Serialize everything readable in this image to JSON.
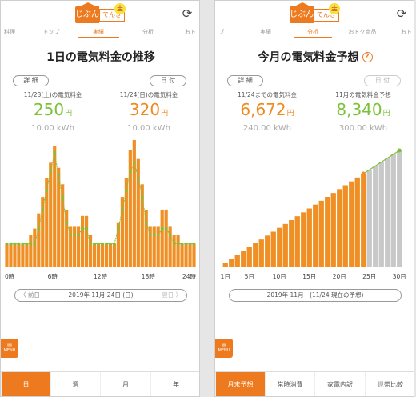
{
  "colors": {
    "accent": "#ee7a1f",
    "bar": "#ef8f24",
    "line": "#7cc13a",
    "forecast": "#c8c8c8"
  },
  "icons": {
    "refresh": "refresh-icon",
    "menu": "menu-icon",
    "help": "help-icon"
  },
  "logo": {
    "left": "じぶん",
    "right": "でんき",
    "coin": "圭"
  },
  "screen1": {
    "tabs": [
      "料理",
      "トップ",
      "実績",
      "分析",
      "おト"
    ],
    "active_tab": 2,
    "title": "1日の電気料金の推移",
    "detail_button": "詳 細",
    "date_button": "日 付",
    "left": {
      "label": "11/23(土)の電気料金",
      "value": "250",
      "unit": "円",
      "sub": "10.00 kWh"
    },
    "right": {
      "label": "11/24(日)の電気料金",
      "value": "320",
      "unit": "円",
      "sub": "10.00 kWh"
    },
    "date_nav": {
      "prev": "前日",
      "date": "2019年 11月 24日 (日)",
      "next": "翌日"
    },
    "menu_label": "MENU",
    "bottom_tabs": [
      "日",
      "週",
      "月",
      "年"
    ],
    "bottom_active": 0
  },
  "screen2": {
    "tabs": [
      "ブ",
      "実績",
      "分析",
      "おトク商品",
      "おト"
    ],
    "active_tab": 2,
    "title": "今月の電気料金予想",
    "detail_button": "詳 細",
    "date_button": "日 付",
    "left": {
      "label": "11/24までの電気料金",
      "value": "6,672",
      "unit": "円",
      "sub": "240.00 kWh"
    },
    "right": {
      "label": "11月の電気料金予想",
      "value": "8,340",
      "unit": "円",
      "sub": "300.00 kWh"
    },
    "month_label": "2019年 11月　(11/24 現在の予想)",
    "menu_label": "MENU",
    "bottom_tabs": [
      "月末予想",
      "常時消費",
      "家電内訳",
      "世帯比較"
    ],
    "bottom_active": 0
  },
  "chart_data": [
    {
      "type": "bar",
      "title": "1日の電気料金の推移",
      "x_ticks": [
        "0時",
        "6時",
        "12時",
        "18時",
        "24時"
      ],
      "ylim": [
        0,
        1
      ],
      "series": [
        {
          "values": [
            0.18,
            0.18,
            0.18,
            0.18,
            0.18,
            0.18,
            0.18,
            0.18,
            0.3,
            0.45,
            0.6,
            0.75,
            0.9,
            0.72,
            0.55,
            0.35,
            0.25,
            0.25,
            0.25,
            0.3,
            0.3,
            0.18,
            0.18,
            0.18,
            0.18,
            0.18,
            0.18,
            0.18,
            0.3,
            0.45,
            0.6,
            0.75,
            0.82,
            0.7,
            0.55,
            0.35,
            0.25,
            0.25,
            0.25,
            0.3,
            0.3,
            0.25,
            0.18,
            0.18,
            0.18,
            0.18,
            0.18,
            0.18
          ]
        },
        {
          "values": [
            0.18,
            0.18,
            0.18,
            0.18,
            0.18,
            0.18,
            0.25,
            0.3,
            0.42,
            0.55,
            0.7,
            0.82,
            0.95,
            0.78,
            0.65,
            0.45,
            0.32,
            0.32,
            0.32,
            0.4,
            0.4,
            0.25,
            0.18,
            0.18,
            0.18,
            0.18,
            0.18,
            0.18,
            0.35,
            0.55,
            0.7,
            0.92,
            1.0,
            0.85,
            0.65,
            0.45,
            0.32,
            0.32,
            0.32,
            0.45,
            0.45,
            0.32,
            0.25,
            0.25,
            0.18,
            0.18,
            0.18,
            0.18
          ]
        }
      ]
    },
    {
      "type": "bar",
      "title": "今月の電気料金予想",
      "x_ticks": [
        "1日",
        "5日",
        "10日",
        "15日",
        "20日",
        "25日",
        "30日"
      ],
      "x": [
        1,
        2,
        3,
        4,
        5,
        6,
        7,
        8,
        9,
        10,
        11,
        12,
        13,
        14,
        15,
        16,
        17,
        18,
        19,
        20,
        21,
        22,
        23,
        24,
        25,
        26,
        27,
        28,
        29,
        30
      ],
      "actual_days": 24,
      "values": [
        1,
        2,
        3,
        4,
        5,
        6,
        7,
        8,
        9,
        10,
        11,
        12,
        13,
        14,
        15,
        16,
        17,
        18,
        19,
        20,
        21,
        22,
        23,
        24,
        25,
        26,
        27,
        28,
        29,
        30
      ]
    }
  ]
}
